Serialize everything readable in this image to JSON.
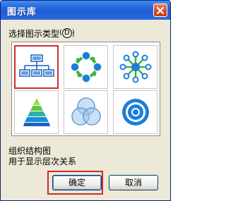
{
  "dialog": {
    "title": "图示库",
    "prompt_label": "选择图示类型",
    "prompt_hotkey": "D",
    "prompt_colon": ":",
    "description_title": "组织结构图",
    "description_text": "用于显示层次关系",
    "ok_label": "确定",
    "cancel_label": "取消"
  },
  "diagram_types": [
    {
      "icon": "organization-chart-icon",
      "selected": true
    },
    {
      "icon": "cycle-diagram-icon",
      "selected": false
    },
    {
      "icon": "radial-diagram-icon",
      "selected": false
    },
    {
      "icon": "pyramid-diagram-icon",
      "selected": false
    },
    {
      "icon": "venn-diagram-icon",
      "selected": false
    },
    {
      "icon": "target-diagram-icon",
      "selected": false
    }
  ],
  "colors": {
    "selection_border": "#d12b2b",
    "title_bar": "#2467dc",
    "icon_primary": "#1a7fd8",
    "icon_secondary": "#3fb23f"
  }
}
